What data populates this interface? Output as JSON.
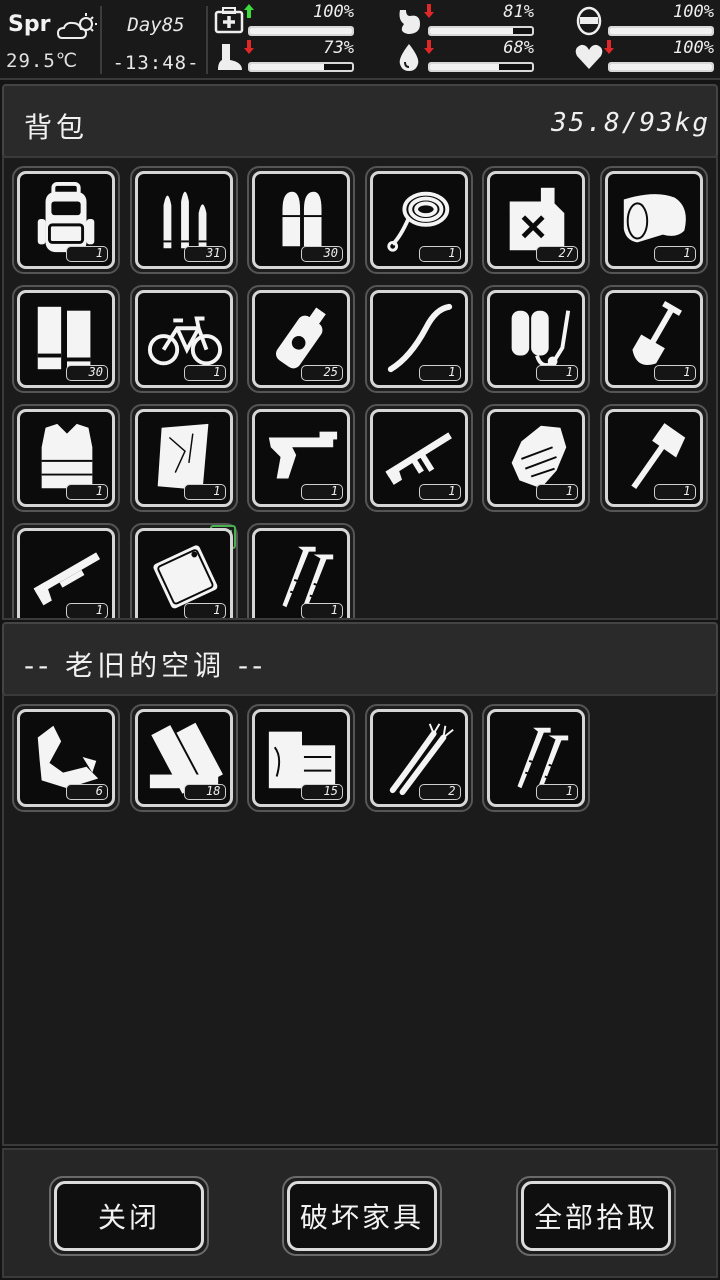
{
  "status": {
    "season": "Spr",
    "temperature": "29.5℃",
    "day": "Day85",
    "time": "-13:48-",
    "stats": [
      {
        "name": "health",
        "icon": "medkit-icon",
        "value": "100%",
        "level": 1.0,
        "trend": "up"
      },
      {
        "name": "hunger",
        "icon": "stomach-icon",
        "value": "81%",
        "level": 0.81,
        "trend": "down"
      },
      {
        "name": "mood",
        "icon": "face-icon",
        "value": "100%",
        "level": 1.0,
        "trend": "none"
      },
      {
        "name": "stamina",
        "icon": "foot-icon",
        "value": "73%",
        "level": 0.73,
        "trend": "down"
      },
      {
        "name": "thirst",
        "icon": "water-drop-icon",
        "value": "68%",
        "level": 0.68,
        "trend": "down"
      },
      {
        "name": "vitality",
        "icon": "heart-icon",
        "value": "100%",
        "level": 1.0,
        "trend": "down"
      }
    ]
  },
  "backpack": {
    "title": "背包",
    "weight": "35.8/93kg",
    "items": [
      {
        "icon": "backpack-icon",
        "count": "1"
      },
      {
        "icon": "rifle-ammo-icon",
        "count": "31"
      },
      {
        "icon": "pistol-ammo-icon",
        "count": "30"
      },
      {
        "icon": "rope-icon",
        "count": "1"
      },
      {
        "icon": "fuel-can-icon",
        "count": "27"
      },
      {
        "icon": "bandage-roll-icon",
        "count": "1"
      },
      {
        "icon": "wood-plank-icon",
        "count": "30"
      },
      {
        "icon": "bicycle-icon",
        "count": "1"
      },
      {
        "icon": "gas-canister-icon",
        "count": "25"
      },
      {
        "icon": "bow-stick-icon",
        "count": "1"
      },
      {
        "icon": "scuba-tank-icon",
        "count": "1"
      },
      {
        "icon": "shovel-icon",
        "count": "1"
      },
      {
        "icon": "body-armor-icon",
        "count": "1"
      },
      {
        "icon": "cloth-icon",
        "count": "1"
      },
      {
        "icon": "pistol-icon",
        "count": "1"
      },
      {
        "icon": "assault-rifle-icon",
        "count": "1"
      },
      {
        "icon": "gauntlet-icon",
        "count": "1"
      },
      {
        "icon": "axe-icon",
        "count": "1"
      },
      {
        "icon": "shotgun-icon",
        "count": "1"
      },
      {
        "icon": "plastic-bag-icon",
        "count": "1",
        "tagged": true
      },
      {
        "icon": "nails-icon",
        "count": "1"
      }
    ]
  },
  "container": {
    "title": "-- 老旧的空调 --",
    "items": [
      {
        "icon": "scrap-metal-icon",
        "count": "6"
      },
      {
        "icon": "wood-boards-icon",
        "count": "18"
      },
      {
        "icon": "wood-block-icon",
        "count": "15"
      },
      {
        "icon": "wires-icon",
        "count": "2"
      },
      {
        "icon": "nails-icon",
        "count": "1"
      }
    ]
  },
  "buttons": {
    "close": "关闭",
    "destroy": "破坏家具",
    "take_all": "全部拾取"
  },
  "colors": {
    "background": "#141414",
    "panel_header": "#2a2a2a",
    "slot_border": "#d6d6d6",
    "up_arrow": "#3ddc3d",
    "down_arrow": "#e02828",
    "tag_border": "#4caf50"
  }
}
